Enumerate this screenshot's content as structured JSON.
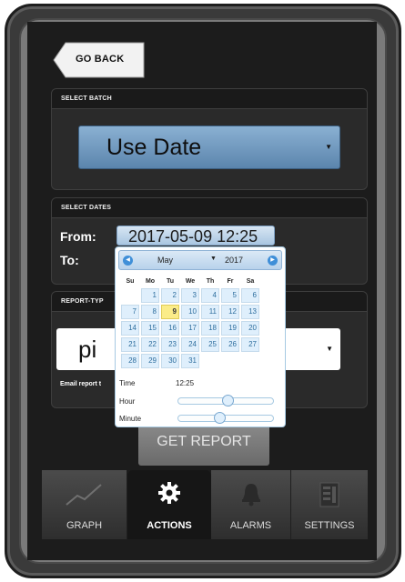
{
  "nav": {
    "go_back": "GO BACK"
  },
  "batch": {
    "header": "SELECT BATCH",
    "selected": "Use Date"
  },
  "dates": {
    "header": "SELECT DATES",
    "from_label": "From:",
    "to_label": "To:",
    "from_value": "2017-05-09 12:25"
  },
  "report": {
    "header": "REPORT-TYP",
    "selected": "pi",
    "email_text": "Email report t"
  },
  "get_report": "GET REPORT",
  "datepicker": {
    "month": "May",
    "year": "2017",
    "weekdays": [
      "Su",
      "Mo",
      "Tu",
      "We",
      "Th",
      "Fr",
      "Sa"
    ],
    "weeks": [
      [
        "",
        "1",
        "2",
        "3",
        "4",
        "5",
        "6"
      ],
      [
        "7",
        "8",
        "9",
        "10",
        "11",
        "12",
        "13"
      ],
      [
        "14",
        "15",
        "16",
        "17",
        "18",
        "19",
        "20"
      ],
      [
        "21",
        "22",
        "23",
        "24",
        "25",
        "26",
        "27"
      ],
      [
        "28",
        "29",
        "30",
        "31",
        "",
        "",
        ""
      ]
    ],
    "selected_day": "9",
    "time_label": "Time",
    "time_value": "12:25",
    "hour_label": "Hour",
    "minute_label": "Minute",
    "hour_fraction": 0.52,
    "minute_fraction": 0.42
  },
  "tabs": [
    {
      "label": "GRAPH",
      "icon": "graph-icon",
      "active": false
    },
    {
      "label": "ACTIONS",
      "icon": "gear-icon",
      "active": true
    },
    {
      "label": "ALARMS",
      "icon": "bell-icon",
      "active": false
    },
    {
      "label": "SETTINGS",
      "icon": "settings-panel-icon",
      "active": false
    }
  ],
  "colors": {
    "accent_blue": "#6d95bd",
    "today_highlight": "#fbec88",
    "background": "#1c1c1c"
  }
}
